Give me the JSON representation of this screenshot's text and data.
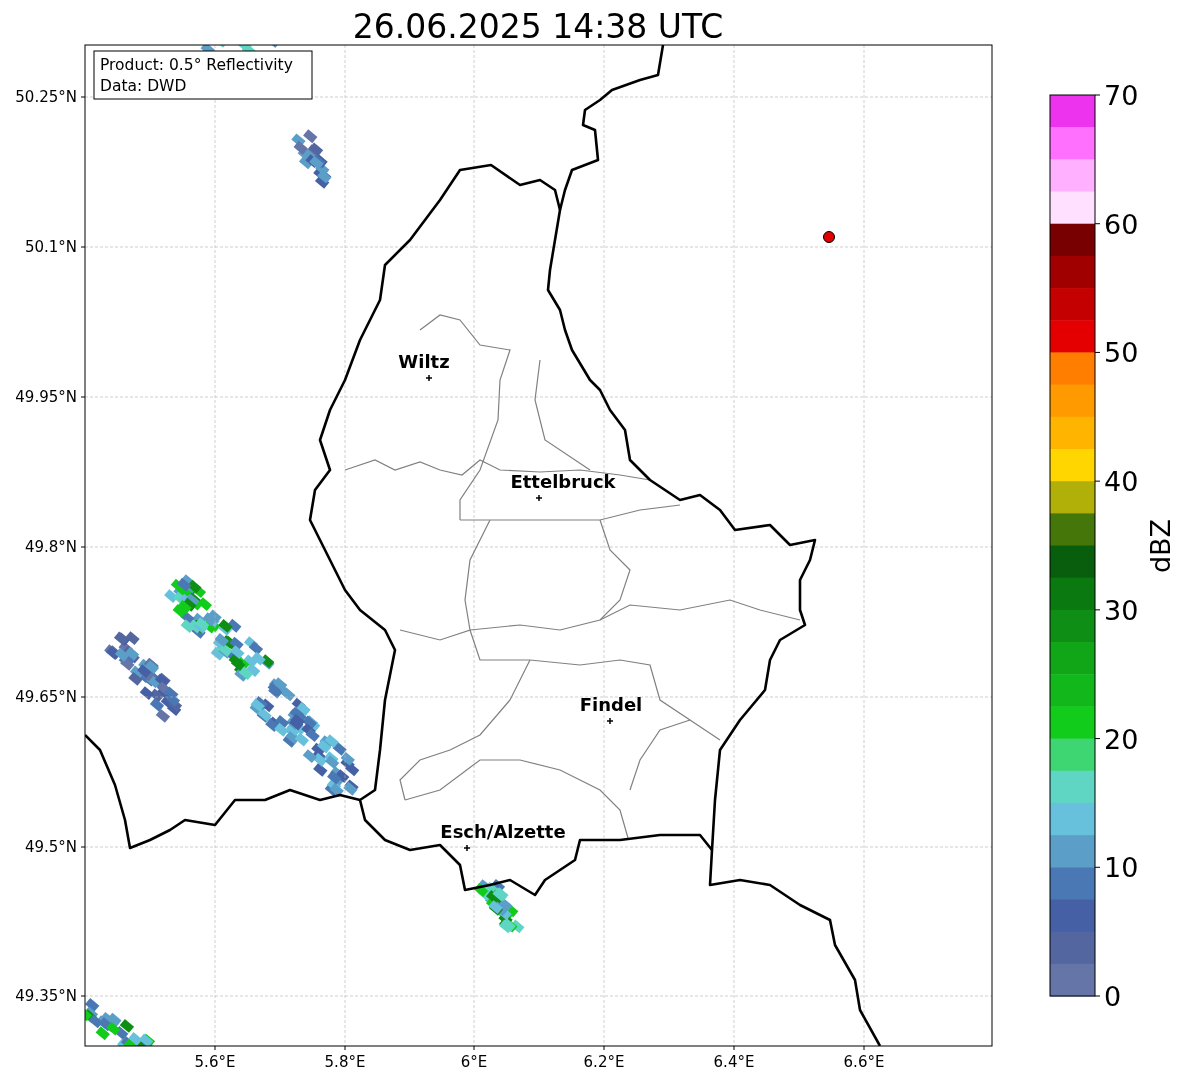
{
  "title": "26.06.2025 14:38 UTC",
  "info_box": [
    "Product: 0.5° Reflectivity",
    "Data: DWD"
  ],
  "y_ticks": [
    "50.25°N",
    "50.1°N",
    "49.95°N",
    "49.8°N",
    "49.65°N",
    "49.5°N",
    "49.35°N"
  ],
  "x_ticks": [
    "5.6°E",
    "5.8°E",
    "6°E",
    "6.2°E",
    "6.4°E",
    "6.6°E"
  ],
  "cities": [
    {
      "name": "Wiltz"
    },
    {
      "name": "Ettelbruck"
    },
    {
      "name": "Findel"
    },
    {
      "name": "Esch/Alzette"
    }
  ],
  "colorbar": {
    "label": "dBZ",
    "ticks": [
      "70",
      "60",
      "50",
      "40",
      "30",
      "20",
      "10",
      "0"
    ],
    "bands": [
      {
        "color": "#ee33ee"
      },
      {
        "color": "#ff70ff"
      },
      {
        "color": "#ffb0ff"
      },
      {
        "color": "#ffe0ff"
      },
      {
        "color": "#780000"
      },
      {
        "color": "#a00000"
      },
      {
        "color": "#c40000"
      },
      {
        "color": "#e40000"
      },
      {
        "color": "#ff7e00"
      },
      {
        "color": "#ff9a00"
      },
      {
        "color": "#ffb400"
      },
      {
        "color": "#ffd600"
      },
      {
        "color": "#b0b008"
      },
      {
        "color": "#44760a"
      },
      {
        "color": "#085e0c"
      },
      {
        "color": "#0a7a10"
      },
      {
        "color": "#0e8e14"
      },
      {
        "color": "#10a618"
      },
      {
        "color": "#12b81b"
      },
      {
        "color": "#12cc1c"
      },
      {
        "color": "#3ed673"
      },
      {
        "color": "#5fd6c4"
      },
      {
        "color": "#67c1dc"
      },
      {
        "color": "#5b9ec8"
      },
      {
        "color": "#4a78b4"
      },
      {
        "color": "#4560a4"
      },
      {
        "color": "#5466a0"
      },
      {
        "color": "#6575a8"
      }
    ]
  }
}
